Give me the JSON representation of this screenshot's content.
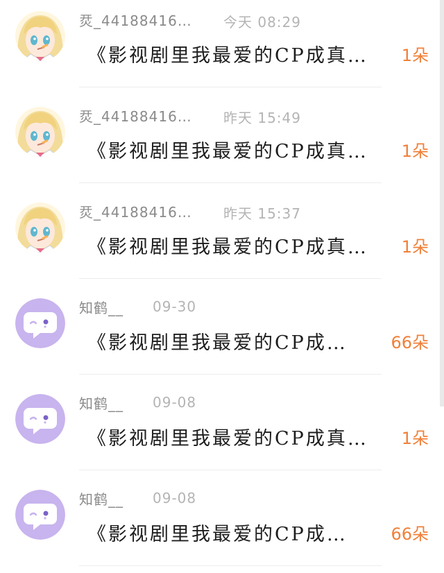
{
  "items": [
    {
      "sender": "烎_44188416…",
      "time": "今天 08:29",
      "message": "《影视剧里我最爱的CP成真…",
      "count": "1朵",
      "avatar": "anime-girl"
    },
    {
      "sender": "烎_44188416…",
      "time": "昨天 15:49",
      "message": "《影视剧里我最爱的CP成真…",
      "count": "1朵",
      "avatar": "anime-girl"
    },
    {
      "sender": "烎_44188416…",
      "time": "昨天 15:37",
      "message": "《影视剧里我最爱的CP成真…",
      "count": "1朵",
      "avatar": "anime-girl"
    },
    {
      "sender": "知鹤__",
      "time": "09-30",
      "message": "《影视剧里我最爱的CP成…",
      "count": "66朵",
      "avatar": "chat-bubble"
    },
    {
      "sender": "知鹤__",
      "time": "09-08",
      "message": "《影视剧里我最爱的CP成真…",
      "count": "1朵",
      "avatar": "chat-bubble"
    },
    {
      "sender": "知鹤__",
      "time": "09-08",
      "message": "《影视剧里我最爱的CP成…",
      "count": "66朵",
      "avatar": "chat-bubble"
    }
  ],
  "colors": {
    "accent_count": "#f0803a",
    "sender_text": "#8a8a8a",
    "time_text": "#b4b4b4",
    "bubble_avatar_bg": "#c8b4ee"
  }
}
